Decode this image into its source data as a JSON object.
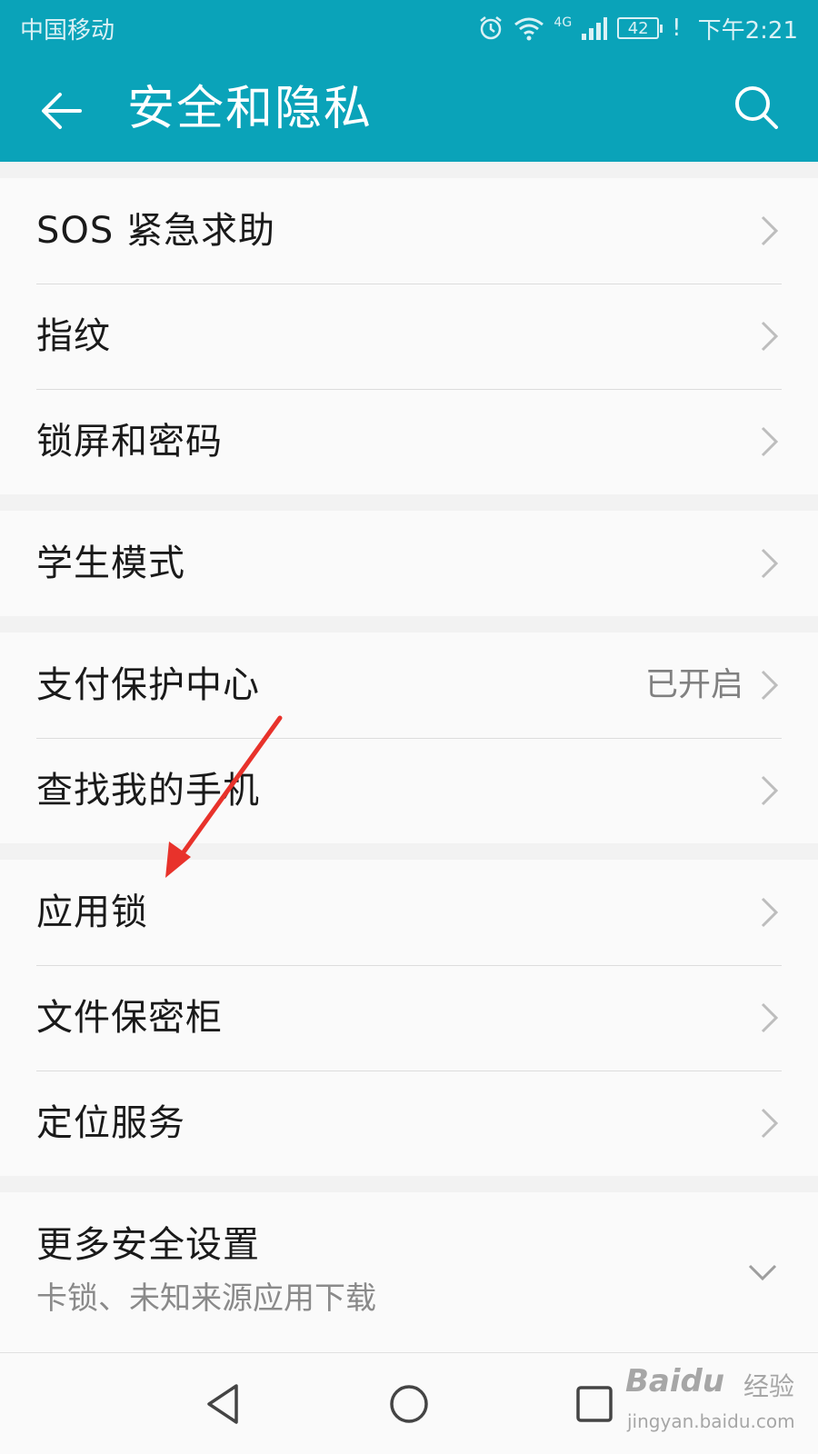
{
  "status_bar": {
    "carrier": "中国移动",
    "network": "4G",
    "battery": "42",
    "alert": "!",
    "time": "下午2:21"
  },
  "app_bar": {
    "title": "安全和隐私",
    "background_color": "#0aa3b9",
    "back_icon": "arrow-left-icon",
    "search_icon": "search-icon"
  },
  "groups": [
    {
      "items": [
        {
          "label": "SOS 紧急求助"
        },
        {
          "label": "指纹"
        },
        {
          "label": "锁屏和密码"
        }
      ]
    },
    {
      "items": [
        {
          "label": "学生模式"
        }
      ]
    },
    {
      "items": [
        {
          "label": "支付保护中心",
          "value": "已开启"
        },
        {
          "label": "查找我的手机"
        }
      ]
    },
    {
      "items": [
        {
          "label": "应用锁"
        },
        {
          "label": "文件保密柜"
        },
        {
          "label": "定位服务"
        }
      ]
    },
    {
      "items": [
        {
          "label": "更多安全设置",
          "sublabel": "卡锁、未知来源应用下载"
        }
      ]
    }
  ],
  "annotation": {
    "arrow_color": "#e8322b"
  },
  "watermark": {
    "brand": "Baidu",
    "suffix": "经验",
    "url": "jingyan.baidu.com"
  }
}
